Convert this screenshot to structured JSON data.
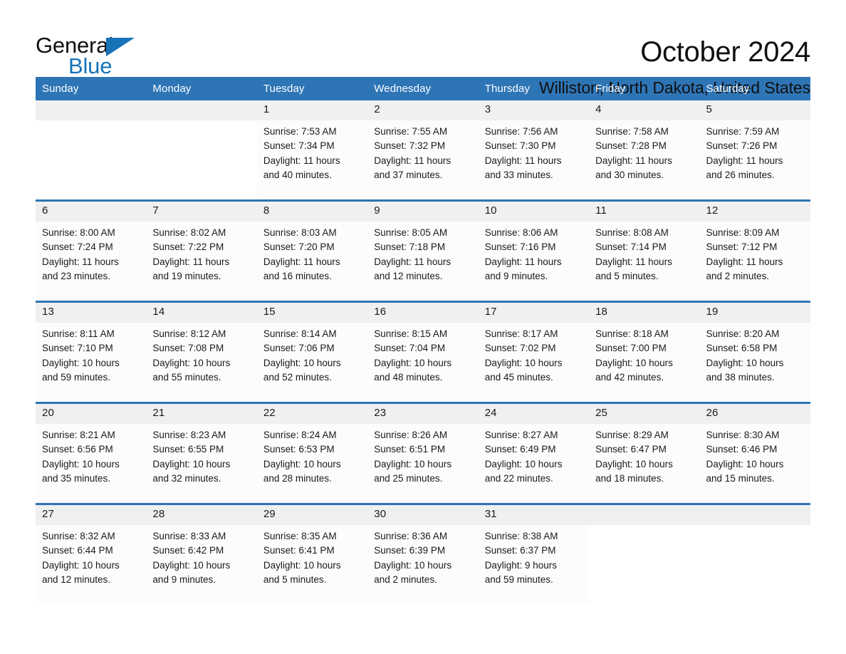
{
  "brand": {
    "name_top": "General",
    "name_bottom": "Blue",
    "accent_color": "#1673b8"
  },
  "header": {
    "title": "October 2024",
    "subtitle": "Williston, North Dakota, United States"
  },
  "theme": {
    "header_blue": "#2e75b6",
    "date_band_gray": "#f0f0f0",
    "cell_white": "#fcfcfc"
  },
  "labels": {
    "sunrise_prefix": "Sunrise:",
    "sunset_prefix": "Sunset:",
    "daylight_prefix": "Daylight:"
  },
  "weekdays": [
    "Sunday",
    "Monday",
    "Tuesday",
    "Wednesday",
    "Thursday",
    "Friday",
    "Saturday"
  ],
  "weeks": [
    [
      {
        "day": ""
      },
      {
        "day": ""
      },
      {
        "day": "1",
        "sunrise": "Sunrise: 7:53 AM",
        "sunset": "Sunset: 7:34 PM",
        "daylight_1": "Daylight: 11 hours",
        "daylight_2": "and 40 minutes."
      },
      {
        "day": "2",
        "sunrise": "Sunrise: 7:55 AM",
        "sunset": "Sunset: 7:32 PM",
        "daylight_1": "Daylight: 11 hours",
        "daylight_2": "and 37 minutes."
      },
      {
        "day": "3",
        "sunrise": "Sunrise: 7:56 AM",
        "sunset": "Sunset: 7:30 PM",
        "daylight_1": "Daylight: 11 hours",
        "daylight_2": "and 33 minutes."
      },
      {
        "day": "4",
        "sunrise": "Sunrise: 7:58 AM",
        "sunset": "Sunset: 7:28 PM",
        "daylight_1": "Daylight: 11 hours",
        "daylight_2": "and 30 minutes."
      },
      {
        "day": "5",
        "sunrise": "Sunrise: 7:59 AM",
        "sunset": "Sunset: 7:26 PM",
        "daylight_1": "Daylight: 11 hours",
        "daylight_2": "and 26 minutes."
      }
    ],
    [
      {
        "day": "6",
        "sunrise": "Sunrise: 8:00 AM",
        "sunset": "Sunset: 7:24 PM",
        "daylight_1": "Daylight: 11 hours",
        "daylight_2": "and 23 minutes."
      },
      {
        "day": "7",
        "sunrise": "Sunrise: 8:02 AM",
        "sunset": "Sunset: 7:22 PM",
        "daylight_1": "Daylight: 11 hours",
        "daylight_2": "and 19 minutes."
      },
      {
        "day": "8",
        "sunrise": "Sunrise: 8:03 AM",
        "sunset": "Sunset: 7:20 PM",
        "daylight_1": "Daylight: 11 hours",
        "daylight_2": "and 16 minutes."
      },
      {
        "day": "9",
        "sunrise": "Sunrise: 8:05 AM",
        "sunset": "Sunset: 7:18 PM",
        "daylight_1": "Daylight: 11 hours",
        "daylight_2": "and 12 minutes."
      },
      {
        "day": "10",
        "sunrise": "Sunrise: 8:06 AM",
        "sunset": "Sunset: 7:16 PM",
        "daylight_1": "Daylight: 11 hours",
        "daylight_2": "and 9 minutes."
      },
      {
        "day": "11",
        "sunrise": "Sunrise: 8:08 AM",
        "sunset": "Sunset: 7:14 PM",
        "daylight_1": "Daylight: 11 hours",
        "daylight_2": "and 5 minutes."
      },
      {
        "day": "12",
        "sunrise": "Sunrise: 8:09 AM",
        "sunset": "Sunset: 7:12 PM",
        "daylight_1": "Daylight: 11 hours",
        "daylight_2": "and 2 minutes."
      }
    ],
    [
      {
        "day": "13",
        "sunrise": "Sunrise: 8:11 AM",
        "sunset": "Sunset: 7:10 PM",
        "daylight_1": "Daylight: 10 hours",
        "daylight_2": "and 59 minutes."
      },
      {
        "day": "14",
        "sunrise": "Sunrise: 8:12 AM",
        "sunset": "Sunset: 7:08 PM",
        "daylight_1": "Daylight: 10 hours",
        "daylight_2": "and 55 minutes."
      },
      {
        "day": "15",
        "sunrise": "Sunrise: 8:14 AM",
        "sunset": "Sunset: 7:06 PM",
        "daylight_1": "Daylight: 10 hours",
        "daylight_2": "and 52 minutes."
      },
      {
        "day": "16",
        "sunrise": "Sunrise: 8:15 AM",
        "sunset": "Sunset: 7:04 PM",
        "daylight_1": "Daylight: 10 hours",
        "daylight_2": "and 48 minutes."
      },
      {
        "day": "17",
        "sunrise": "Sunrise: 8:17 AM",
        "sunset": "Sunset: 7:02 PM",
        "daylight_1": "Daylight: 10 hours",
        "daylight_2": "and 45 minutes."
      },
      {
        "day": "18",
        "sunrise": "Sunrise: 8:18 AM",
        "sunset": "Sunset: 7:00 PM",
        "daylight_1": "Daylight: 10 hours",
        "daylight_2": "and 42 minutes."
      },
      {
        "day": "19",
        "sunrise": "Sunrise: 8:20 AM",
        "sunset": "Sunset: 6:58 PM",
        "daylight_1": "Daylight: 10 hours",
        "daylight_2": "and 38 minutes."
      }
    ],
    [
      {
        "day": "20",
        "sunrise": "Sunrise: 8:21 AM",
        "sunset": "Sunset: 6:56 PM",
        "daylight_1": "Daylight: 10 hours",
        "daylight_2": "and 35 minutes."
      },
      {
        "day": "21",
        "sunrise": "Sunrise: 8:23 AM",
        "sunset": "Sunset: 6:55 PM",
        "daylight_1": "Daylight: 10 hours",
        "daylight_2": "and 32 minutes."
      },
      {
        "day": "22",
        "sunrise": "Sunrise: 8:24 AM",
        "sunset": "Sunset: 6:53 PM",
        "daylight_1": "Daylight: 10 hours",
        "daylight_2": "and 28 minutes."
      },
      {
        "day": "23",
        "sunrise": "Sunrise: 8:26 AM",
        "sunset": "Sunset: 6:51 PM",
        "daylight_1": "Daylight: 10 hours",
        "daylight_2": "and 25 minutes."
      },
      {
        "day": "24",
        "sunrise": "Sunrise: 8:27 AM",
        "sunset": "Sunset: 6:49 PM",
        "daylight_1": "Daylight: 10 hours",
        "daylight_2": "and 22 minutes."
      },
      {
        "day": "25",
        "sunrise": "Sunrise: 8:29 AM",
        "sunset": "Sunset: 6:47 PM",
        "daylight_1": "Daylight: 10 hours",
        "daylight_2": "and 18 minutes."
      },
      {
        "day": "26",
        "sunrise": "Sunrise: 8:30 AM",
        "sunset": "Sunset: 6:46 PM",
        "daylight_1": "Daylight: 10 hours",
        "daylight_2": "and 15 minutes."
      }
    ],
    [
      {
        "day": "27",
        "sunrise": "Sunrise: 8:32 AM",
        "sunset": "Sunset: 6:44 PM",
        "daylight_1": "Daylight: 10 hours",
        "daylight_2": "and 12 minutes."
      },
      {
        "day": "28",
        "sunrise": "Sunrise: 8:33 AM",
        "sunset": "Sunset: 6:42 PM",
        "daylight_1": "Daylight: 10 hours",
        "daylight_2": "and 9 minutes."
      },
      {
        "day": "29",
        "sunrise": "Sunrise: 8:35 AM",
        "sunset": "Sunset: 6:41 PM",
        "daylight_1": "Daylight: 10 hours",
        "daylight_2": "and 5 minutes."
      },
      {
        "day": "30",
        "sunrise": "Sunrise: 8:36 AM",
        "sunset": "Sunset: 6:39 PM",
        "daylight_1": "Daylight: 10 hours",
        "daylight_2": "and 2 minutes."
      },
      {
        "day": "31",
        "sunrise": "Sunrise: 8:38 AM",
        "sunset": "Sunset: 6:37 PM",
        "daylight_1": "Daylight: 9 hours",
        "daylight_2": "and 59 minutes."
      },
      {
        "day": ""
      },
      {
        "day": ""
      }
    ]
  ]
}
